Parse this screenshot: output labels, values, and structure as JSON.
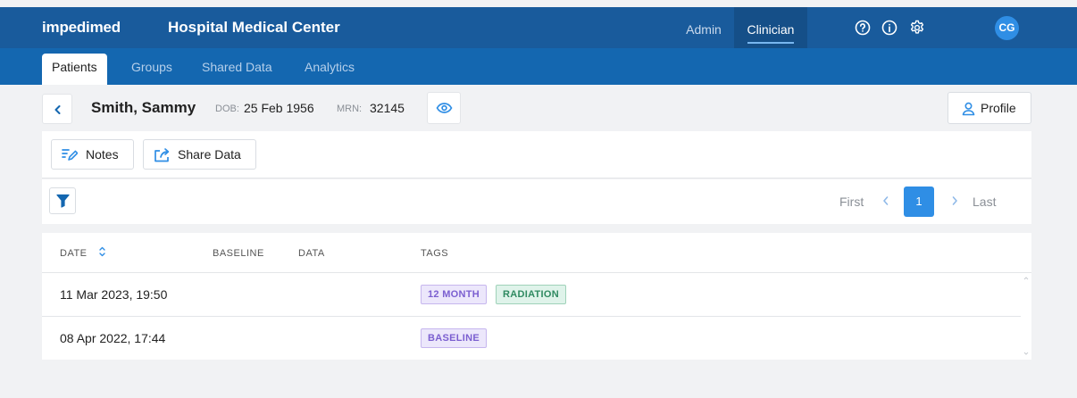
{
  "brand": {
    "logo_text": "impedimed",
    "organization": "Hospital Medical Center"
  },
  "roles": {
    "admin": "Admin",
    "clinician": "Clinician"
  },
  "topbar_icons": [
    "help-icon",
    "info-icon",
    "settings-icon"
  ],
  "user": {
    "initials": "CG"
  },
  "nav": {
    "tabs": [
      "Patients",
      "Groups",
      "Shared Data",
      "Analytics"
    ],
    "active": "Patients"
  },
  "patient": {
    "name": "Smith, Sammy",
    "dob_label": "DOB:",
    "dob": "25 Feb 1956",
    "mrn_label": "MRN:",
    "mrn": "32145"
  },
  "actions": {
    "profile": "Profile",
    "notes": "Notes",
    "share_data": "Share Data"
  },
  "pagination": {
    "first": "First",
    "current": "1",
    "last": "Last"
  },
  "table": {
    "columns": [
      "DATE",
      "BASELINE",
      "DATA",
      "TAGS"
    ],
    "rows": [
      {
        "date": "11 Mar 2023, 19:50",
        "tags": [
          "12 MONTH",
          "RADIATION"
        ]
      },
      {
        "date": "08 Apr 2022, 17:44",
        "tags": [
          "BASELINE"
        ]
      }
    ]
  },
  "colors": {
    "topbar": "#195b9c",
    "navbar": "#1467b0",
    "accent": "#2f8ee5",
    "tag_purple": "#7b5fd0",
    "tag_green": "#2f8a61"
  }
}
